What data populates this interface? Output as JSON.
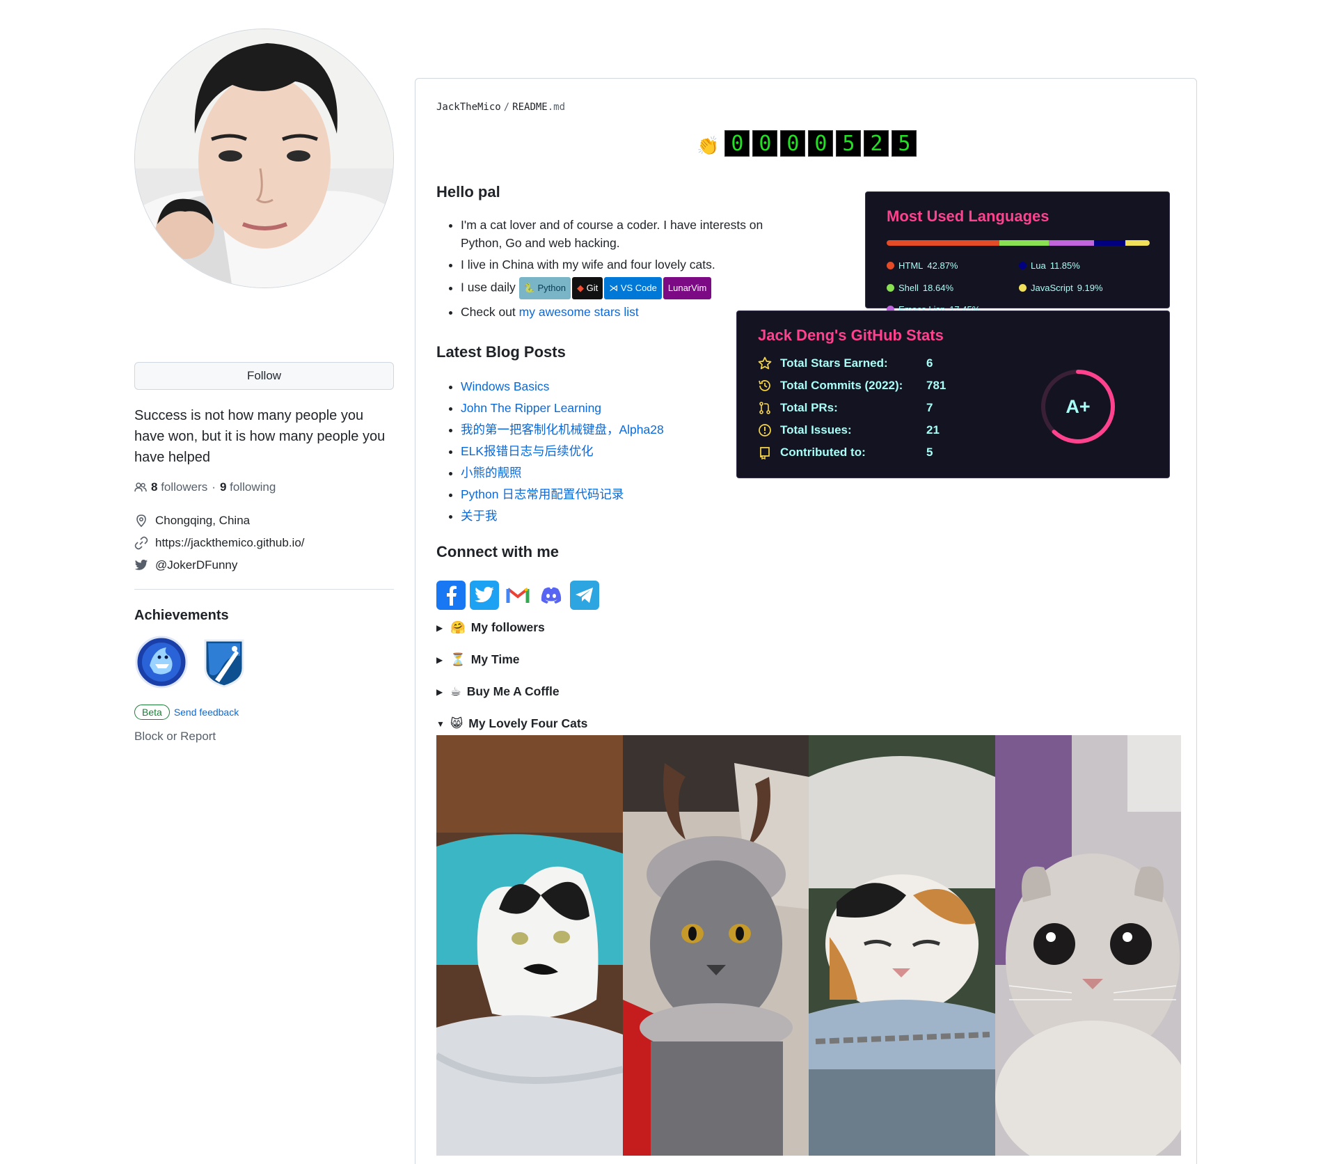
{
  "sidebar": {
    "follow_label": "Follow",
    "bio": "Success is not how many people you have won, but it is how many people you have helped",
    "followers_count": "8",
    "followers_label": "followers",
    "dot": "·",
    "following_count": "9",
    "following_label": "following",
    "location": "Chongqing, China",
    "website": "https://jackthemico.github.io/",
    "twitter": "@JokerDFunny",
    "achievements_title": "Achievements",
    "beta_label": "Beta",
    "feedback_label": "Send feedback",
    "block_label": "Block or Report"
  },
  "readme": {
    "owner": "JackTheMico",
    "separator": "/",
    "file_name": "README",
    "file_ext": ".md",
    "counter_icon": "👏",
    "counter_digits": [
      "0",
      "0",
      "0",
      "0",
      "5",
      "2",
      "5"
    ],
    "hello_title": "Hello pal",
    "intro_1": "I'm a cat lover and of course a coder. I have interests on Python, Go and web hacking.",
    "intro_2": "I live in China with my wife and four lovely cats.",
    "intro_3_prefix": "I use daily",
    "tools": [
      {
        "label": "Python",
        "color": "#7ab5c7"
      },
      {
        "label": "Git",
        "color": "#111111"
      },
      {
        "label": "VS Code",
        "color": "#0078d7"
      },
      {
        "label": "LunarVim",
        "color": "#7d0a85"
      }
    ],
    "intro_4_prefix": "Check out",
    "stars_link": "my awesome stars list",
    "blog_title": "Latest Blog Posts",
    "blog_posts": [
      "Windows Basics",
      "John The Ripper Learning",
      "我的第一把客制化机械键盘，Alpha28",
      "ELK报错日志与后续优化",
      "小熊的靓照",
      "Python 日志常用配置代码记录",
      "关于我"
    ],
    "connect_title": "Connect with me",
    "social_icons": [
      "facebook-icon",
      "twitter-icon",
      "gmail-icon",
      "discord-icon",
      "telegram-icon"
    ],
    "details": [
      {
        "emoji": "🤗",
        "label": "My followers",
        "open": false
      },
      {
        "emoji": "⏳",
        "label": "My Time",
        "open": false
      },
      {
        "emoji": "☕",
        "label": "Buy Me A Coffle",
        "open": false
      },
      {
        "emoji": "😸",
        "label": "My Lovely Four Cats",
        "open": true
      }
    ]
  },
  "languages_card": {
    "title": "Most Used Languages",
    "languages": [
      {
        "name": "HTML",
        "percent": "42.87%",
        "value": 42.87,
        "color": "#e34c26"
      },
      {
        "name": "Lua",
        "percent": "11.85%",
        "value": 11.85,
        "color": "#000080"
      },
      {
        "name": "Shell",
        "percent": "18.64%",
        "value": 18.64,
        "color": "#89e051"
      },
      {
        "name": "JavaScript",
        "percent": "9.19%",
        "value": 9.19,
        "color": "#f1e05a"
      },
      {
        "name": "Emacs Lisp",
        "percent": "17.45%",
        "value": 17.45,
        "color": "#c065db"
      }
    ]
  },
  "stats_card": {
    "title": "Jack Deng's GitHub Stats",
    "rows": [
      {
        "icon": "star-icon",
        "label": "Total Stars Earned:",
        "value": "6"
      },
      {
        "icon": "history-icon",
        "label": "Total Commits (2022):",
        "value": "781"
      },
      {
        "icon": "pull-request-icon",
        "label": "Total PRs:",
        "value": "7"
      },
      {
        "icon": "issue-icon",
        "label": "Total Issues:",
        "value": "21"
      },
      {
        "icon": "repo-icon",
        "label": "Contributed to:",
        "value": "5"
      }
    ],
    "grade": "A+",
    "ring_color": "#fe428e",
    "ring_progress": 0.62
  },
  "colors": {
    "link": "#0969da",
    "card_bg": "#141321",
    "card_title": "#fe428e",
    "card_text": "#a9fef7",
    "icon_yellow": "#f8d847"
  }
}
